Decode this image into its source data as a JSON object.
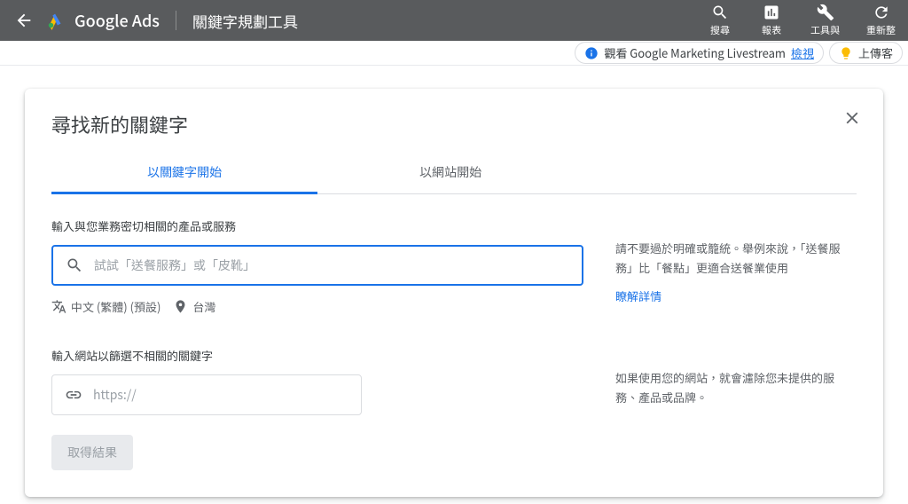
{
  "header": {
    "brand": "Google Ads",
    "page_title": "關鍵字規劃工具",
    "actions": {
      "search": "搜尋",
      "reports": "報表",
      "tools": "工具與",
      "refresh": "重新整"
    }
  },
  "notification": {
    "text": "觀看 Google Marketing Livestream",
    "link": "檢視",
    "upload": "上傳客"
  },
  "card": {
    "title": "尋找新的關鍵字",
    "tabs": {
      "keyword": "以關鍵字開始",
      "website": "以網站開始"
    },
    "section1": {
      "label": "輸入與您業務密切相關的產品或服務",
      "placeholder": "試試「送餐服務」或「皮靴」",
      "help": "請不要過於明確或籠統。舉例來說，「送餐服務」比「餐點」更適合送餐業使用",
      "help_link": "瞭解詳情",
      "lang": "中文 (繁體) (預設)",
      "location": "台灣"
    },
    "section2": {
      "label": "輸入網站以篩選不相關的關鍵字",
      "placeholder": "https://",
      "help": "如果使用您的網站，就會濾除您未提供的服務、產品或品牌。"
    },
    "submit": "取得結果"
  }
}
